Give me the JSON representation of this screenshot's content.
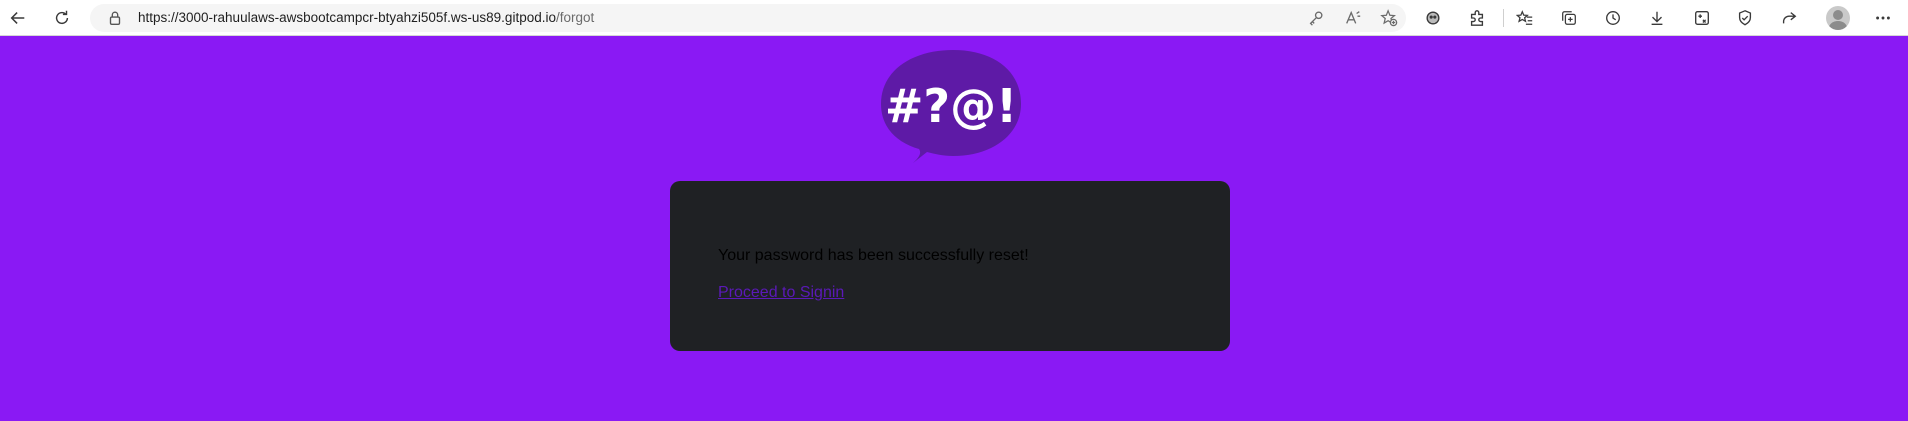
{
  "browser": {
    "url_host": "https://3000-rahuulaws-awsbootcampcr-btyahzi505f.ws-us89.gitpod.io",
    "url_path": "/forgot"
  },
  "page": {
    "logo_text": "#?@!",
    "message": "Your password has been successfully reset!",
    "signin_link": "Proceed to Signin"
  },
  "colors": {
    "background": "#8a19f4",
    "card": "#1f2124",
    "logo_bubble": "#5e1aa6",
    "link": "#5b19b8"
  }
}
